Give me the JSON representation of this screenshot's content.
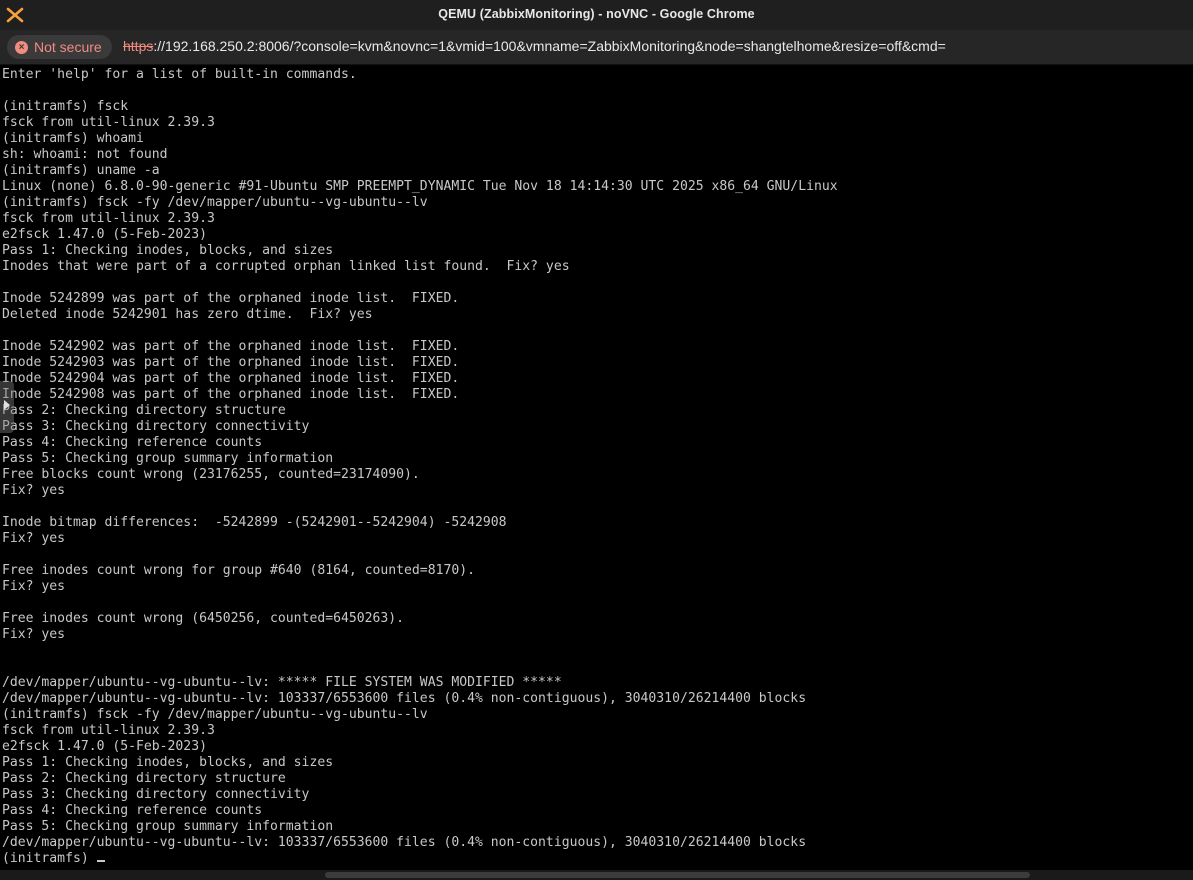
{
  "window": {
    "title": "QEMU (ZabbixMonitoring) - noVNC - Google Chrome",
    "app_icon": "novnc-x-icon",
    "accent_color": "#f5a23a"
  },
  "address_bar": {
    "security_label": "Not secure",
    "security_icon": "warning-icon",
    "url_scheme": "https",
    "url_rest": "://192.168.250.2:8006/?console=kvm&novnc=1&vmid=100&vmname=ZabbixMonitoring&node=shangtelhome&resize=off&cmd="
  },
  "terminal": {
    "lines": [
      "Enter 'help' for a list of built-in commands.",
      "",
      "(initramfs) fsck",
      "fsck from util-linux 2.39.3",
      "(initramfs) whoami",
      "sh: whoami: not found",
      "(initramfs) uname -a",
      "Linux (none) 6.8.0-90-generic #91-Ubuntu SMP PREEMPT_DYNAMIC Tue Nov 18 14:14:30 UTC 2025 x86_64 GNU/Linux",
      "(initramfs) fsck -fy /dev/mapper/ubuntu--vg-ubuntu--lv",
      "fsck from util-linux 2.39.3",
      "e2fsck 1.47.0 (5-Feb-2023)",
      "Pass 1: Checking inodes, blocks, and sizes",
      "Inodes that were part of a corrupted orphan linked list found.  Fix? yes",
      "",
      "Inode 5242899 was part of the orphaned inode list.  FIXED.",
      "Deleted inode 5242901 has zero dtime.  Fix? yes",
      "",
      "Inode 5242902 was part of the orphaned inode list.  FIXED.",
      "Inode 5242903 was part of the orphaned inode list.  FIXED.",
      "Inode 5242904 was part of the orphaned inode list.  FIXED.",
      "Inode 5242908 was part of the orphaned inode list.  FIXED.",
      "Pass 2: Checking directory structure",
      "Pass 3: Checking directory connectivity",
      "Pass 4: Checking reference counts",
      "Pass 5: Checking group summary information",
      "Free blocks count wrong (23176255, counted=23174090).",
      "Fix? yes",
      "",
      "Inode bitmap differences:  -5242899 -(5242901--5242904) -5242908",
      "Fix? yes",
      "",
      "Free inodes count wrong for group #640 (8164, counted=8170).",
      "Fix? yes",
      "",
      "Free inodes count wrong (6450256, counted=6450263).",
      "Fix? yes",
      "",
      "",
      "/dev/mapper/ubuntu--vg-ubuntu--lv: ***** FILE SYSTEM WAS MODIFIED *****",
      "/dev/mapper/ubuntu--vg-ubuntu--lv: 103337/6553600 files (0.4% non-contiguous), 3040310/26214400 blocks",
      "(initramfs) fsck -fy /dev/mapper/ubuntu--vg-ubuntu--lv",
      "fsck from util-linux 2.39.3",
      "e2fsck 1.47.0 (5-Feb-2023)",
      "Pass 1: Checking inodes, blocks, and sizes",
      "Pass 2: Checking directory structure",
      "Pass 3: Checking directory connectivity",
      "Pass 4: Checking reference counts",
      "Pass 5: Checking group summary information",
      "/dev/mapper/ubuntu--vg-ubuntu--lv: 103337/6553600 files (0.4% non-contiguous), 3040310/26214400 blocks"
    ],
    "prompt": "(initramfs) ",
    "text_color": "#c8c8c8",
    "background_color": "#000000"
  },
  "novnc": {
    "control_handle_icon": "expand-arrow-icon"
  }
}
